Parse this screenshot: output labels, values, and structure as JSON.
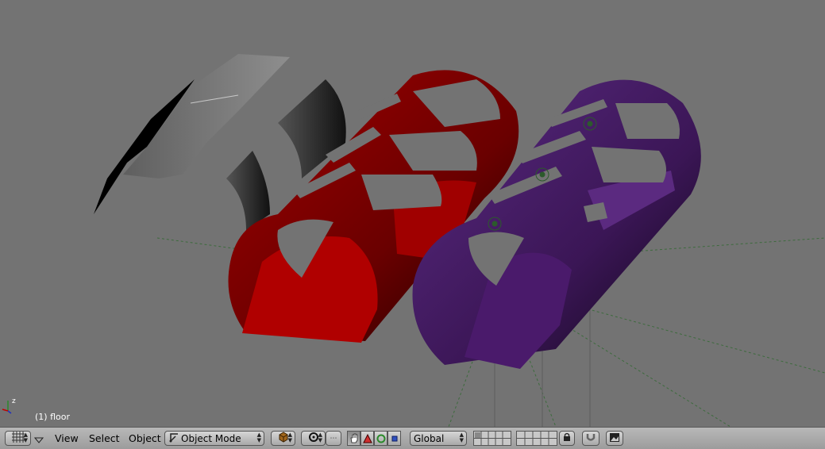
{
  "viewport": {
    "object_label": "(1) floor",
    "axis_z_label": "z",
    "colors": {
      "background": "#737373",
      "red_object": "#8b0000",
      "purple_object": "#4a1a6b",
      "gray_object": "#8a8a8a",
      "dark_object": "#2a2a2a"
    }
  },
  "header": {
    "menus": [
      "View",
      "Select",
      "Object"
    ],
    "mode_label": "Object Mode",
    "orientation_label": "Global",
    "icons": {
      "editor_type": "grid-icon",
      "collapse": "triangle-down-icon",
      "mode": "object-mode-icon",
      "shading": "shading-cube-icon",
      "pivot": "pivot-icon",
      "manip_toggle": "hand-icon",
      "translate": "translate-icon",
      "rotate": "rotate-icon",
      "scale": "scale-icon",
      "lock": "lock-icon",
      "proportional": "magnet-icon",
      "render": "render-preview-icon"
    }
  }
}
